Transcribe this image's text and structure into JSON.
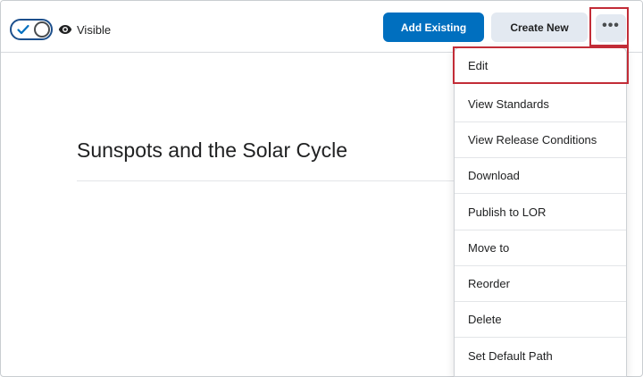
{
  "toolbar": {
    "visibility_label": "Visible",
    "add_existing_label": "Add Existing",
    "create_new_label": "Create New",
    "more_label": "•••"
  },
  "content": {
    "title": "Sunspots and the Solar Cycle"
  },
  "menu": {
    "items": [
      {
        "label": "Edit"
      },
      {
        "label": "View Standards"
      },
      {
        "label": "View Release Conditions"
      },
      {
        "label": "Download"
      },
      {
        "label": "Publish to LOR"
      },
      {
        "label": "Move to"
      },
      {
        "label": "Reorder"
      },
      {
        "label": "Delete"
      },
      {
        "label": "Set Default Path"
      }
    ]
  },
  "colors": {
    "primary": "#006fbf",
    "secondary_bg": "#e3e9f1",
    "highlight": "#c22c37",
    "toggle_accent": "#1c4f8c"
  },
  "icons": {
    "toggle_check": "check-icon",
    "visibility": "eye-icon"
  }
}
